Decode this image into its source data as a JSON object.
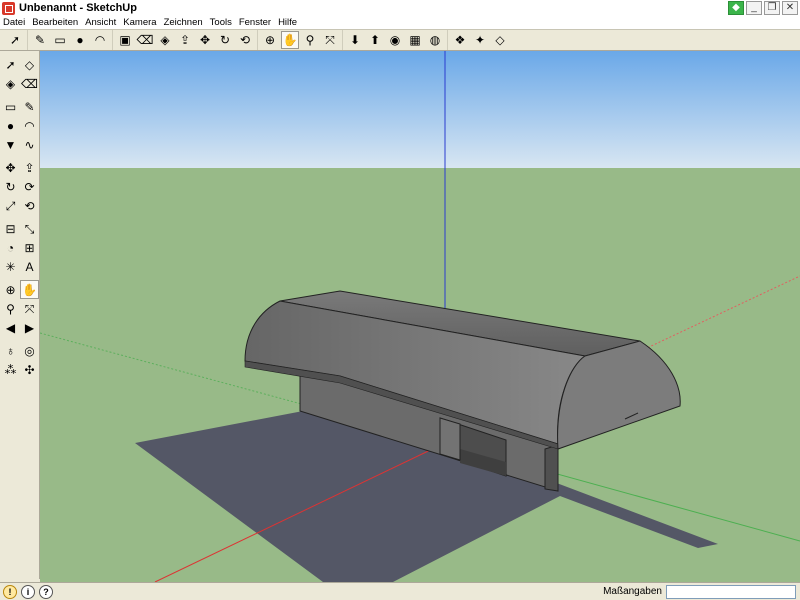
{
  "window": {
    "title": "Unbenannt - SketchUp"
  },
  "menubar": {
    "items": [
      "Datei",
      "Bearbeiten",
      "Ansicht",
      "Kamera",
      "Zeichnen",
      "Tools",
      "Fenster",
      "Hilfe"
    ]
  },
  "toolbar": {
    "buttons": [
      {
        "name": "select-icon",
        "glyph": "➚"
      },
      {
        "name": "pencil-icon",
        "glyph": "✎"
      },
      {
        "name": "rectangle-icon",
        "glyph": "▭"
      },
      {
        "name": "circle-icon",
        "glyph": "●"
      },
      {
        "name": "arc-icon",
        "glyph": "◠"
      },
      {
        "name": "make-component-icon",
        "glyph": "▣"
      },
      {
        "name": "eraser-icon",
        "glyph": "⌫"
      },
      {
        "name": "paint-bucket-icon",
        "glyph": "◈"
      },
      {
        "name": "push-pull-icon",
        "glyph": "⇪"
      },
      {
        "name": "move-icon",
        "glyph": "✥"
      },
      {
        "name": "rotate-icon",
        "glyph": "↻"
      },
      {
        "name": "offset-icon",
        "glyph": "⟲"
      },
      {
        "name": "orbit-icon",
        "glyph": "⊕"
      },
      {
        "name": "pan-icon",
        "glyph": "✋"
      },
      {
        "name": "zoom-icon",
        "glyph": "⚲"
      },
      {
        "name": "zoom-extents-icon",
        "glyph": "⤧"
      },
      {
        "name": "get-models-icon",
        "glyph": "⬇"
      },
      {
        "name": "share-model-icon",
        "glyph": "⬆"
      },
      {
        "name": "geo-location-icon",
        "glyph": "◉"
      },
      {
        "name": "photo-textures-icon",
        "glyph": "▦"
      },
      {
        "name": "google-earth-icon",
        "glyph": "◍"
      },
      {
        "name": "component-icon",
        "glyph": "❖"
      },
      {
        "name": "extension-icon",
        "glyph": "✦"
      },
      {
        "name": "box-icon",
        "glyph": "◇"
      }
    ]
  },
  "left_toolbar": {
    "rows": [
      [
        {
          "name": "select-icon",
          "glyph": "➚"
        },
        {
          "name": "make-component-icon",
          "glyph": "◇"
        }
      ],
      [
        {
          "name": "paint-bucket-icon",
          "glyph": "◈"
        },
        {
          "name": "eraser-icon",
          "glyph": "⌫"
        }
      ],
      "sep",
      [
        {
          "name": "rectangle-icon",
          "glyph": "▭"
        },
        {
          "name": "pencil-icon",
          "glyph": "✎"
        }
      ],
      [
        {
          "name": "circle-icon",
          "glyph": "●"
        },
        {
          "name": "arc-icon",
          "glyph": "◠"
        }
      ],
      [
        {
          "name": "polygon-icon",
          "glyph": "▼"
        },
        {
          "name": "freehand-icon",
          "glyph": "∿"
        }
      ],
      "sep",
      [
        {
          "name": "move-icon",
          "glyph": "✥"
        },
        {
          "name": "push-pull-icon",
          "glyph": "⇪"
        }
      ],
      [
        {
          "name": "rotate-icon",
          "glyph": "↻"
        },
        {
          "name": "follow-me-icon",
          "glyph": "⟳"
        }
      ],
      [
        {
          "name": "scale-icon",
          "glyph": "⤢"
        },
        {
          "name": "offset-icon",
          "glyph": "⟲"
        }
      ],
      "sep",
      [
        {
          "name": "tape-measure-icon",
          "glyph": "⊟"
        },
        {
          "name": "dimension-icon",
          "glyph": "⤡"
        }
      ],
      [
        {
          "name": "protractor-icon",
          "glyph": "◔"
        },
        {
          "name": "text-icon",
          "glyph": "⊞"
        }
      ],
      [
        {
          "name": "axes-icon",
          "glyph": "✳"
        },
        {
          "name": "3d-text-icon",
          "glyph": "A"
        }
      ],
      "sep",
      [
        {
          "name": "orbit-icon",
          "glyph": "⊕"
        },
        {
          "name": "pan-icon",
          "glyph": "✋"
        }
      ],
      [
        {
          "name": "zoom-icon",
          "glyph": "⚲"
        },
        {
          "name": "zoom-extents-icon",
          "glyph": "⤧"
        }
      ],
      [
        {
          "name": "previous-view-icon",
          "glyph": "◀"
        },
        {
          "name": "next-view-icon",
          "glyph": "▶"
        }
      ],
      "sep",
      [
        {
          "name": "position-camera-icon",
          "glyph": "♁"
        },
        {
          "name": "look-around-icon",
          "glyph": "◎"
        }
      ],
      [
        {
          "name": "walk-icon",
          "glyph": "⁂"
        },
        {
          "name": "section-plane-icon",
          "glyph": "✣"
        }
      ]
    ]
  },
  "statusbar": {
    "measurements_label": "Maßangaben",
    "measurements_value": ""
  },
  "colors": {
    "sky_top": "#6aa8e8",
    "sky_bottom": "#d8e6f2",
    "ground": "#98ba88",
    "shadow": "#545766",
    "axis_blue": "#2a3ccf",
    "axis_red": "#d33",
    "axis_green": "#4caf50"
  }
}
